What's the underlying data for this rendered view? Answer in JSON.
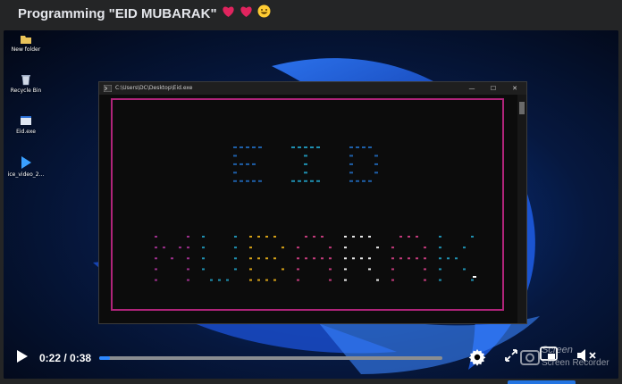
{
  "post": {
    "title": "Programming \"EID MUBARAK\"",
    "emojis": [
      "heart-emoji",
      "heart-emoji",
      "grinning-face-emoji"
    ]
  },
  "desktop": {
    "icons": [
      {
        "name": "folder-icon",
        "label": "New folder"
      },
      {
        "name": "recycle-bin-icon",
        "label": "Recycle Bin"
      },
      {
        "name": "exe-icon",
        "label": "Eid.exe"
      },
      {
        "name": "video-icon",
        "label": "ice_video_2..."
      }
    ]
  },
  "console": {
    "title": "C:\\Users\\DC\\Desktop\\Eid.exe",
    "buttons": {
      "minimize": "—",
      "maximize": "☐",
      "close": "✕"
    },
    "frame_color": "#b0247a",
    "art": {
      "line1": "EID",
      "line2": "MUBARAK",
      "eid_colors": [
        "#1e5fa8",
        "#1f8fb0",
        "#1e5fa8"
      ],
      "mubarak_colors": [
        "#9b2f8a",
        "#1f8fb0",
        "#d4a017",
        "#c03a7a",
        "#e8e8e8",
        "#c03a7a",
        "#1f8fb0"
      ]
    }
  },
  "player": {
    "current_time": "0:22",
    "separator": " / ",
    "duration": "0:38",
    "progress": 0.03,
    "accent": "#2d88ff",
    "watermark_line1": "Screen",
    "watermark_line2": "Screen Recorder"
  }
}
